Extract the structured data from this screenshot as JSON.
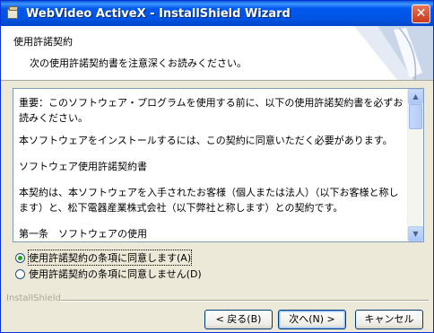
{
  "window": {
    "title": "WebVideo ActiveX - InstallShield Wizard",
    "close_glyph": "✕"
  },
  "header": {
    "title": "使用許諾契約",
    "subtitle": "次の使用許諾契約書を注意深くお読みください。"
  },
  "license": {
    "paragraphs": [
      "重要：このソフトウェア・プログラムを使用する前に、以下の使用許諾契約書を必ずお読みください。",
      "本ソフトウェアをインストールするには、この契約に同意いただく必要があります。",
      "ソフトウェア使用許諾契約書",
      "本契約は、本ソフトウェアを入手されたお客様（個人または法人）（以下お客様と称します）と、松下電器産業株式会社（以下弊社と称します）との契約です。",
      "第一条　ソフトウェアの使用"
    ]
  },
  "options": {
    "accept_label": "使用許諾契約の条項に同意します(A)",
    "decline_label": "使用許諾契約の条項に同意しません(D)",
    "selected": "accept"
  },
  "footer": {
    "brand": "InstallShield"
  },
  "buttons": {
    "back": "< 戻る(B)",
    "next": "次へ(N) >",
    "cancel": "キャンセル"
  },
  "icons": {
    "app": "installer-box-icon",
    "close": "close-icon",
    "scroll_up": "scroll-up-arrow-icon",
    "scroll_down": "scroll-down-arrow-icon"
  }
}
